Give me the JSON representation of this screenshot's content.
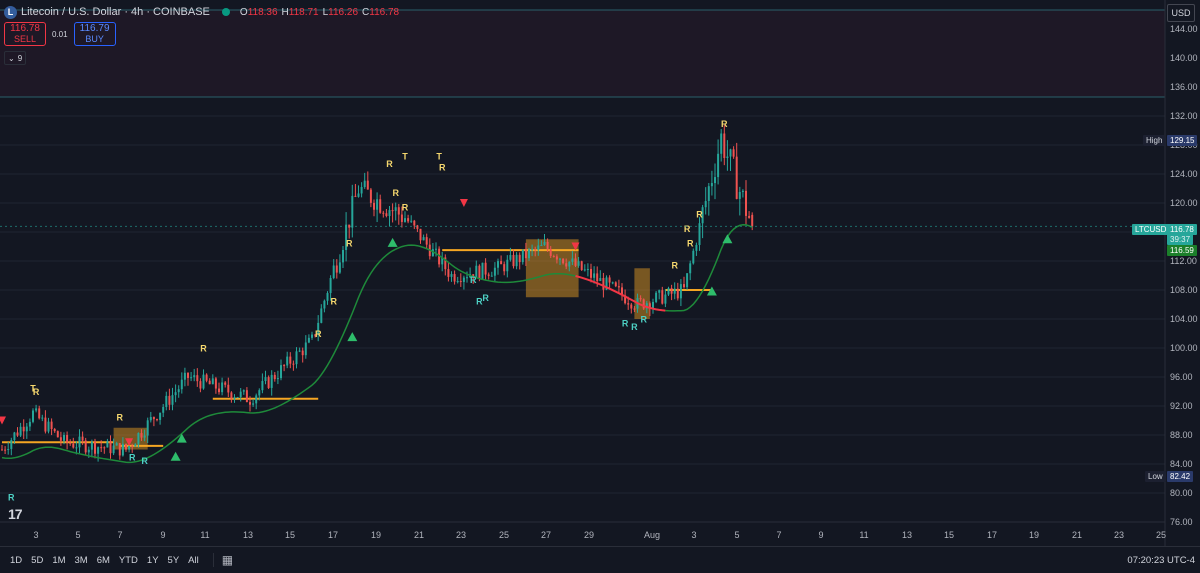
{
  "header": {
    "symbol_title": "Litecoin / U.S. Dollar · 4h · COINBASE",
    "coin_icon": "L",
    "ohlc": [
      {
        "key": "O",
        "value": "118.36"
      },
      {
        "key": "H",
        "value": "118.71"
      },
      {
        "key": "L",
        "value": "116.26"
      },
      {
        "key": "C",
        "value": "116.78"
      }
    ]
  },
  "trade": {
    "sell_price": "116.78",
    "sell_label": "SELL",
    "spread": "0.01",
    "buy_price": "116.79",
    "buy_label": "BUY"
  },
  "indicators_toggle": {
    "count": "9"
  },
  "currency": "USD",
  "price_axis": {
    "ticks": [
      "144.00",
      "140.00",
      "136.00",
      "132.00",
      "128.00",
      "124.00",
      "120.00",
      "116.00",
      "112.00",
      "108.00",
      "104.00",
      "100.00",
      "96.00",
      "92.00",
      "88.00",
      "84.00",
      "80.00",
      "76.00"
    ]
  },
  "price_tags": {
    "high_label": "High",
    "high_value": "129.15",
    "ticker_label": "LTCUSD",
    "current_price": "116.78",
    "countdown": "39:37",
    "ma_value": "116.59",
    "low_label": "Low",
    "low_value": "82.42"
  },
  "time_axis": {
    "labels": [
      "3",
      "5",
      "7",
      "9",
      "11",
      "13",
      "15",
      "17",
      "19",
      "21",
      "23",
      "25",
      "27",
      "29",
      "Aug",
      "3",
      "5",
      "7",
      "9",
      "11",
      "13",
      "15",
      "17",
      "19",
      "21",
      "23",
      "25"
    ]
  },
  "toolbar": {
    "timeframes": [
      "1D",
      "5D",
      "1M",
      "3M",
      "6M",
      "YTD",
      "1Y",
      "5Y",
      "All"
    ],
    "clock": "07:20:23 UTC-4"
  },
  "logo_text": "17",
  "colors": {
    "background": "#131722",
    "up": "#26a69a",
    "down": "#ef5350",
    "trail_up": "#1e8a3a",
    "trail_down": "#f23645",
    "range": "#f5a623",
    "label_yellow": "#f5d76e",
    "label_teal": "#4dd0c4"
  },
  "chart_data": {
    "type": "candlestick",
    "interval": "4h",
    "ylim": [
      76,
      146
    ],
    "key_points": [
      {
        "t": 0,
        "close": 86
      },
      {
        "t": 10,
        "close": 91
      },
      {
        "t": 20,
        "close": 87
      },
      {
        "t": 40,
        "close": 86
      },
      {
        "t": 60,
        "close": 96
      },
      {
        "t": 80,
        "close": 93
      },
      {
        "t": 100,
        "close": 101
      },
      {
        "t": 115,
        "close": 122
      },
      {
        "t": 130,
        "close": 118
      },
      {
        "t": 145,
        "close": 110
      },
      {
        "t": 160,
        "close": 111
      },
      {
        "t": 175,
        "close": 114
      },
      {
        "t": 190,
        "close": 110
      },
      {
        "t": 205,
        "close": 106
      },
      {
        "t": 220,
        "close": 108
      },
      {
        "t": 232,
        "close": 129
      },
      {
        "t": 242,
        "close": 116.78
      }
    ],
    "markers": [
      {
        "text": "R",
        "t": 3,
        "price": 79,
        "kind": "teal"
      },
      {
        "text": "T",
        "t": 10,
        "price": 94,
        "kind": "yellow"
      },
      {
        "text": "R",
        "t": 11,
        "price": 93.5,
        "kind": "yellow"
      },
      {
        "text": "R",
        "t": 38,
        "price": 90,
        "kind": "yellow"
      },
      {
        "text": "R",
        "t": 42,
        "price": 84.5,
        "kind": "teal"
      },
      {
        "text": "R",
        "t": 46,
        "price": 84,
        "kind": "teal"
      },
      {
        "text": "R",
        "t": 65,
        "price": 99.5,
        "kind": "yellow"
      },
      {
        "text": "R",
        "t": 102,
        "price": 101.5,
        "kind": "yellow"
      },
      {
        "text": "R",
        "t": 107,
        "price": 106,
        "kind": "yellow"
      },
      {
        "text": "R",
        "t": 112,
        "price": 114,
        "kind": "yellow"
      },
      {
        "text": "R",
        "t": 125,
        "price": 125,
        "kind": "yellow"
      },
      {
        "text": "T",
        "t": 130,
        "price": 126,
        "kind": "yellow"
      },
      {
        "text": "R",
        "t": 127,
        "price": 121,
        "kind": "yellow"
      },
      {
        "text": "R",
        "t": 130,
        "price": 119,
        "kind": "yellow"
      },
      {
        "text": "T",
        "t": 141,
        "price": 126,
        "kind": "yellow"
      },
      {
        "text": "R",
        "t": 142,
        "price": 124.5,
        "kind": "yellow"
      },
      {
        "text": "R",
        "t": 152,
        "price": 109,
        "kind": "teal"
      },
      {
        "text": "R",
        "t": 154,
        "price": 106,
        "kind": "teal"
      },
      {
        "text": "R",
        "t": 156,
        "price": 106.5,
        "kind": "teal"
      },
      {
        "text": "R",
        "t": 201,
        "price": 103,
        "kind": "teal"
      },
      {
        "text": "R",
        "t": 204,
        "price": 102.5,
        "kind": "teal"
      },
      {
        "text": "R",
        "t": 207,
        "price": 103.5,
        "kind": "teal"
      },
      {
        "text": "R",
        "t": 217,
        "price": 111,
        "kind": "yellow"
      },
      {
        "text": "R",
        "t": 221,
        "price": 116,
        "kind": "yellow"
      },
      {
        "text": "R",
        "t": 222,
        "price": 114,
        "kind": "yellow"
      },
      {
        "text": "R",
        "t": 225,
        "price": 118,
        "kind": "yellow"
      },
      {
        "text": "R",
        "t": 233,
        "price": 130.5,
        "kind": "yellow"
      }
    ]
  }
}
